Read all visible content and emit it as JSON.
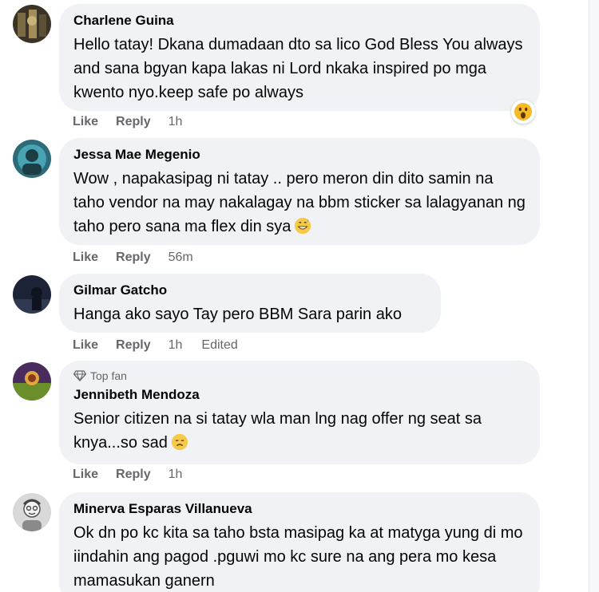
{
  "comments": [
    {
      "author": "Charlene Guina",
      "text": "Hello tatay! Dkana dumadaan dto sa lico God Bless You always and sana bgyan kapa lakas ni Lord nkaka inspired po mga kwento nyo.keep safe po always",
      "like_label": "Like",
      "reply_label": "Reply",
      "time": "1h",
      "reaction_icon": "wow-reaction-icon"
    },
    {
      "author": "Jessa Mae Megenio",
      "text": "Wow , napakasipag ni tatay .. pero meron din dito samin na taho vendor na may nakalagay na bbm sticker sa lalagyanan ng taho pero sana ma flex din sya",
      "text_emoji": "grinning-sweat-emoji",
      "like_label": "Like",
      "reply_label": "Reply",
      "time": "56m"
    },
    {
      "author": "Gilmar Gatcho",
      "text": "Hanga ako sayo Tay pero BBM Sara parin ako",
      "like_label": "Like",
      "reply_label": "Reply",
      "time": "1h",
      "edited_label": "Edited"
    },
    {
      "badge": "Top fan",
      "badge_icon": "diamond-icon",
      "author": "Jennibeth Mendoza",
      "text": "Senior citizen na si tatay wla man lng nag offer ng seat sa knya...so sad",
      "text_emoji": "sad-face-emoji",
      "like_label": "Like",
      "reply_label": "Reply",
      "time": "1h"
    },
    {
      "author": "Minerva Esparas Villanueva",
      "text": "Ok dn po kc kita sa taho bsta masipag ka at matyga yung di mo iindahin ang pagod .pguwi mo kc sure na ang pera mo kesa mamasukan ganern"
    }
  ],
  "colors": {
    "bubble": "#f0f2f5",
    "text": "#050505",
    "meta": "#65676b"
  }
}
